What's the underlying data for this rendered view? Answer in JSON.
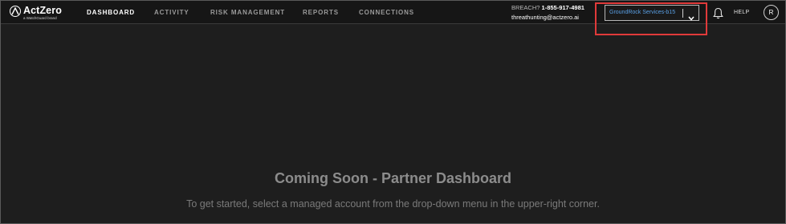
{
  "brand": {
    "name": "ActZero",
    "tagline": "a WatchGuard brand"
  },
  "nav": {
    "items": [
      {
        "label": "DASHBOARD",
        "active": true
      },
      {
        "label": "ACTIVITY",
        "active": false
      },
      {
        "label": "RISK MANAGEMENT",
        "active": false
      },
      {
        "label": "REPORTS",
        "active": false
      },
      {
        "label": "CONNECTIONS",
        "active": false
      }
    ]
  },
  "contact": {
    "breach_label": "BREACH?",
    "phone": "1-855-917-4981",
    "email": "threathunting@actzero.ai"
  },
  "account_select": {
    "value": "GroundRock Services-b15",
    "icon": "chevron-down-icon"
  },
  "header_actions": {
    "notifications_icon": "bell-icon",
    "help_label": "HELP",
    "avatar_initial": "R"
  },
  "main": {
    "title": "Coming Soon - Partner Dashboard",
    "subtitle": "To get started, select a managed account from the drop-down menu in the upper-right corner."
  },
  "colors": {
    "background": "#1e1e1e",
    "navbar": "#161616",
    "select_text": "#5aa0e6",
    "highlight": "#e03a3a"
  }
}
